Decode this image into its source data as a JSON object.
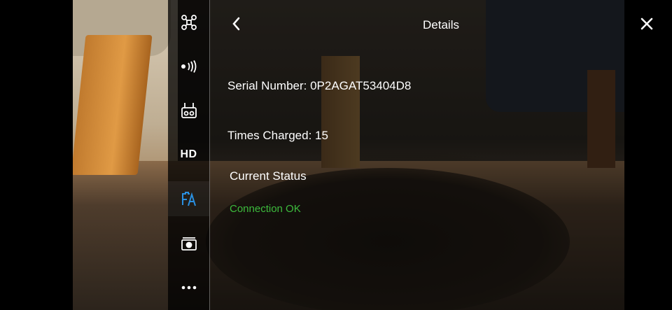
{
  "header": {
    "title": "Details"
  },
  "rail": {
    "items": [
      {
        "icon": "drone-icon"
      },
      {
        "icon": "signal-icon"
      },
      {
        "icon": "remote-controller-icon"
      },
      {
        "icon": "hd-icon",
        "label": "HD"
      },
      {
        "icon": "battery-details-icon",
        "active": true
      },
      {
        "icon": "camera-icon"
      },
      {
        "icon": "more-icon"
      }
    ]
  },
  "details": {
    "serial_number": "Serial Number: 0P2AGAT53404D8",
    "times_charged": "Times Charged: 15",
    "current_status_label": "Current Status",
    "current_status_value": "Connection OK"
  },
  "colors": {
    "status_ok": "#3dbb3d",
    "active_icon": "#2a8fe0"
  }
}
